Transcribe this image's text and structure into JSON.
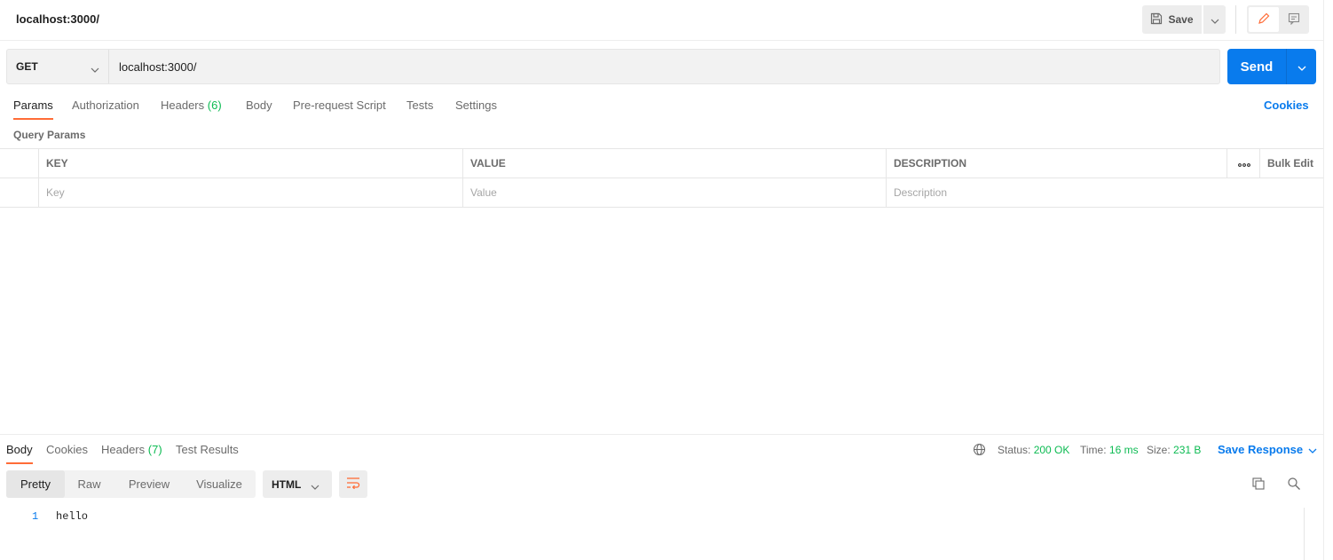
{
  "request": {
    "title": "localhost:3000/",
    "save_label": "Save",
    "method": "GET",
    "url": "localhost:3000/",
    "send_label": "Send"
  },
  "request_tabs": [
    {
      "label": "Params",
      "active": true
    },
    {
      "label": "Authorization"
    },
    {
      "label": "Headers",
      "count": "(6)"
    },
    {
      "label": "Body"
    },
    {
      "label": "Pre-request Script"
    },
    {
      "label": "Tests"
    },
    {
      "label": "Settings"
    }
  ],
  "cookies_label": "Cookies",
  "params": {
    "section_label": "Query Params",
    "columns": [
      "KEY",
      "VALUE",
      "DESCRIPTION"
    ],
    "bulk_edit_label": "Bulk Edit",
    "placeholders": {
      "key": "Key",
      "value": "Value",
      "description": "Description"
    }
  },
  "response": {
    "tabs": [
      {
        "label": "Body",
        "active": true
      },
      {
        "label": "Cookies"
      },
      {
        "label": "Headers",
        "count": "(7)"
      },
      {
        "label": "Test Results"
      }
    ],
    "status_label": "Status:",
    "status_value": "200 OK",
    "time_label": "Time:",
    "time_value": "16 ms",
    "size_label": "Size:",
    "size_value": "231 B",
    "save_response_label": "Save Response",
    "views": [
      "Pretty",
      "Raw",
      "Preview",
      "Visualize"
    ],
    "language": "HTML",
    "lines": [
      {
        "number": "1",
        "text": "hello"
      }
    ]
  },
  "colors": {
    "accent_orange": "#ff6c37",
    "primary_blue": "#097bed",
    "success_green": "#0cbb52"
  }
}
